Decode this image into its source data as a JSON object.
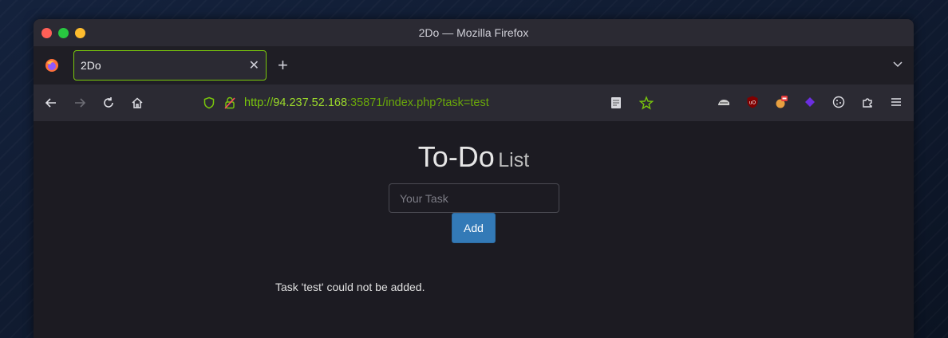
{
  "window": {
    "title": "2Do — Mozilla Firefox"
  },
  "tabs": [
    {
      "label": "2Do",
      "active": true
    }
  ],
  "urlbar": {
    "protocol": "http://",
    "host": "94.237.52.168",
    "rest": ":35871/index.php?task=test"
  },
  "page": {
    "heading_big": "To-Do",
    "heading_small": "List",
    "task_input": {
      "value": "",
      "placeholder": "Your Task"
    },
    "add_button": "Add",
    "message": "Task 'test' could not be added."
  },
  "colors": {
    "accent": "#7ac70c",
    "button": "#337ab7"
  }
}
